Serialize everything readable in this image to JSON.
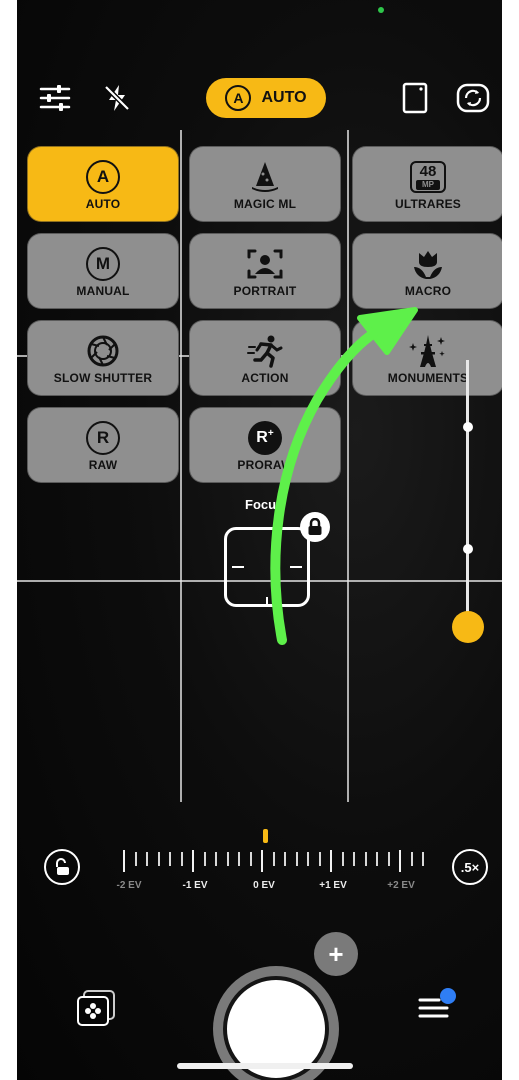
{
  "toolbar": {
    "mode_label": "AUTO",
    "mode_badge": "A"
  },
  "modes": [
    {
      "label": "AUTO",
      "badge": "A",
      "active": true
    },
    {
      "label": "MAGIC ML",
      "active": false
    },
    {
      "label": "ULTRARES",
      "badge": "48",
      "badge_sub": "MP",
      "active": false
    },
    {
      "label": "MANUAL",
      "badge": "M",
      "active": false
    },
    {
      "label": "PORTRAIT",
      "active": false
    },
    {
      "label": "MACRO",
      "active": false
    },
    {
      "label": "SLOW SHUTTER",
      "active": false
    },
    {
      "label": "ACTION",
      "active": false
    },
    {
      "label": "MONUMENTS",
      "active": false
    },
    {
      "label": "RAW",
      "badge": "R",
      "active": false
    },
    {
      "label": "PRORAW",
      "badge": "R",
      "active": false
    }
  ],
  "focus": {
    "label": "Focus"
  },
  "exposure": {
    "labels": [
      "-2 EV",
      "-1 EV",
      "0 EV",
      "+1 EV",
      "+2 EV"
    ],
    "value": "0 EV"
  },
  "zoom": {
    "label": ".5×"
  },
  "colors": {
    "accent": "#f7b915",
    "annotation_arrow": "#5ef04a",
    "tile": "#8f8f8f",
    "notification": "#2f7ef5"
  },
  "icons": {
    "top_left": "sliders-icon",
    "flash": "flash-off-icon",
    "aspect": "aspect-ratio-icon",
    "switch_camera": "switch-camera-icon",
    "exposure_lock": "unlock-icon",
    "gallery": "gallery-icon",
    "menu": "menu-announcement-icon"
  }
}
